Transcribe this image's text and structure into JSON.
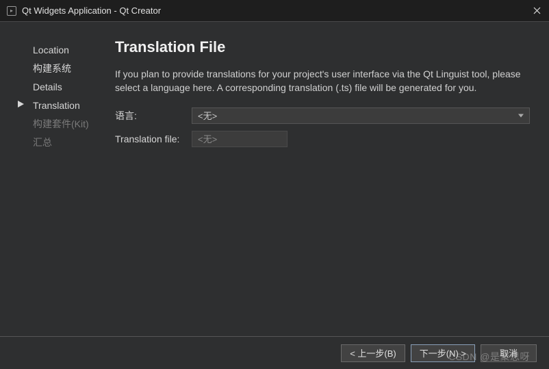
{
  "window": {
    "title": "Qt Widgets Application - Qt Creator"
  },
  "sidebar": {
    "items": [
      {
        "label": "Location",
        "state": "done"
      },
      {
        "label": "构建系统",
        "state": "done"
      },
      {
        "label": "Details",
        "state": "done"
      },
      {
        "label": "Translation",
        "state": "current"
      },
      {
        "label": "构建套件(Kit)",
        "state": "disabled"
      },
      {
        "label": "汇总",
        "state": "disabled"
      }
    ]
  },
  "main": {
    "heading": "Translation File",
    "description": "If you plan to provide translations for your project's user interface via the Qt Linguist tool, please select a language here. A corresponding translation (.ts) file will be generated for you.",
    "language_label": "语言:",
    "language_value": "<无>",
    "file_label": "Translation file:",
    "file_value": "<无>"
  },
  "buttons": {
    "back_full": "< 上一步(B)",
    "next_full": "下一步(N) >",
    "cancel": "取消"
  },
  "watermark": "CSDN @是聚思呀"
}
